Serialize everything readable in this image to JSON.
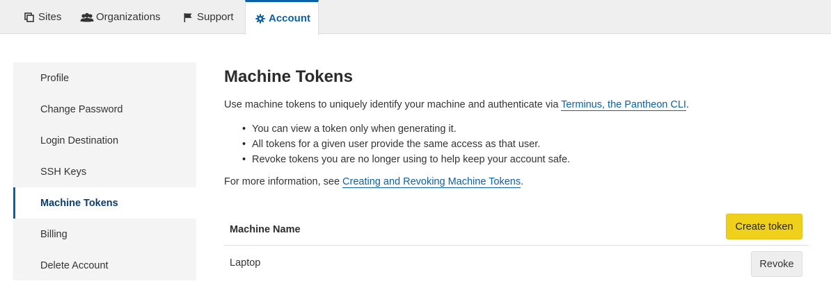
{
  "topnav": {
    "tabs": [
      {
        "label": "Sites",
        "icon": "sites-icon"
      },
      {
        "label": "Organizations",
        "icon": "users-icon"
      },
      {
        "label": "Support",
        "icon": "flag-icon"
      },
      {
        "label": "Account",
        "icon": "gear-icon",
        "active": true
      }
    ]
  },
  "sidebar": {
    "items": [
      {
        "label": "Profile"
      },
      {
        "label": "Change Password"
      },
      {
        "label": "Login Destination"
      },
      {
        "label": "SSH Keys"
      },
      {
        "label": "Machine Tokens",
        "active": true
      },
      {
        "label": "Billing"
      },
      {
        "label": "Delete Account"
      }
    ]
  },
  "main": {
    "title": "Machine Tokens",
    "intro_text": "Use machine tokens to uniquely identify your machine and authenticate via ",
    "intro_link": "Terminus, the Pantheon CLI",
    "intro_end": ".",
    "bullets": [
      "You can view a token only when generating it.",
      "All tokens for a given user provide the same access as that user.",
      "Revoke tokens you are no longer using to help keep your account safe."
    ],
    "more_text": "For more information, see ",
    "more_link": "Creating and Revoking Machine Tokens",
    "more_end": ".",
    "table": {
      "column_header": "Machine Name",
      "create_button": "Create token",
      "rows": [
        {
          "name": "Laptop",
          "action": "Revoke"
        }
      ]
    }
  },
  "colors": {
    "accent": "#0a61a8",
    "create_button": "#efd01b",
    "nav_background": "#efefef",
    "sidebar_background": "#f4f4f4"
  }
}
